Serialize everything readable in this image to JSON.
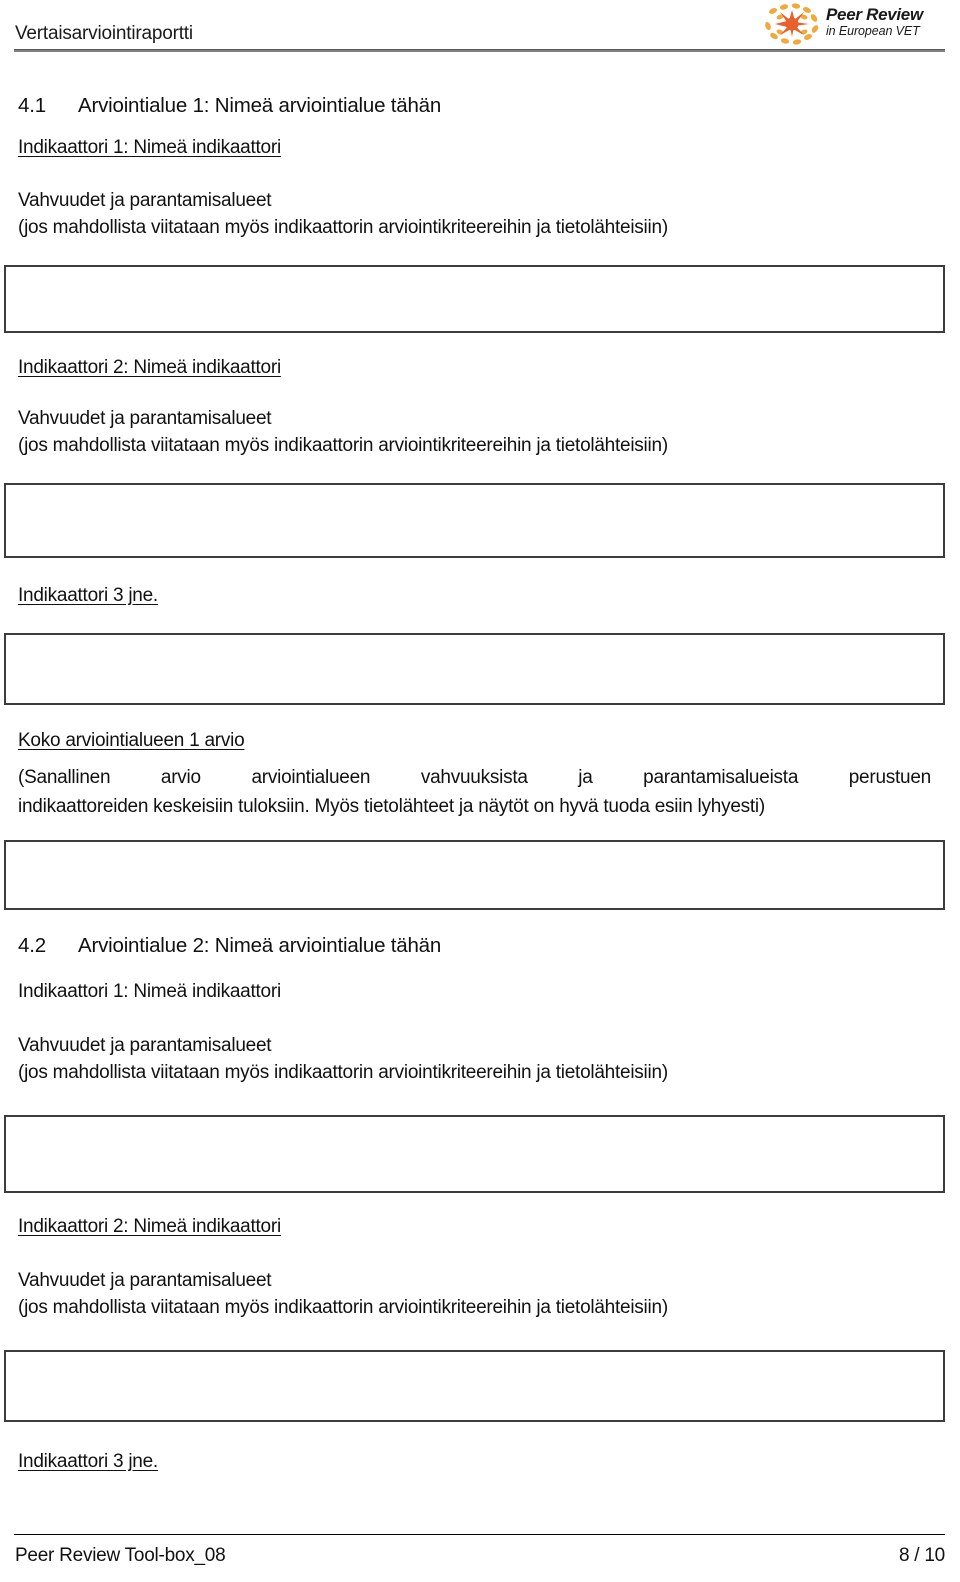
{
  "header": {
    "title": "Vertaisarviointiraportti",
    "logo": {
      "line1": "Peer Review",
      "line2": "in European VET",
      "burst_color": "#E8612C",
      "dot_color": "#F2A93B"
    }
  },
  "sections": [
    {
      "number": "4.1",
      "title": "Arviointialue 1: Nimeä arviointialue tähän",
      "indicator1_label": "Indikaattori 1: Nimeä indikaattori",
      "strengths_label": "Vahvuudet ja parantamisalueet",
      "strengths_hint": "(jos mahdollista viitataan myös indikaattorin arviointikriteereihin ja tietolähteisiin)",
      "indicator2_label": "Indikaattori 2: Nimeä indikaattori",
      "strengths_label2": "Vahvuudet ja parantamisalueet",
      "strengths_hint2": "(jos mahdollista viitataan myös indikaattorin arviointikriteereihin ja tietolähteisiin)",
      "indicator3_label": "Indikaattori 3 jne.",
      "overall_label": "Koko arviointialueen 1 arvio",
      "overall_hint_line1": "(Sanallinen arvio arviointialueen vahvuuksista ja parantamisalueista perustuen",
      "overall_hint_line2": "indikaattoreiden keskeisiin tuloksiin. Myös tietolähteet ja näytöt on hyvä tuoda esiin lyhyesti)"
    },
    {
      "number": "4.2",
      "title": "Arviointialue 2: Nimeä arviointialue tähän",
      "indicator1_label": "Indikaattori 1: Nimeä indikaattori",
      "strengths_label": "Vahvuudet ja parantamisalueet",
      "strengths_hint": "(jos mahdollista viitataan myös indikaattorin arviointikriteereihin ja tietolähteisiin)",
      "indicator2_label": "Indikaattori 2: Nimeä indikaattori",
      "strengths_label2": "Vahvuudet ja parantamisalueet",
      "strengths_hint2": "(jos mahdollista viitataan myös indikaattorin arviointikriteereihin ja tietolähteisiin)",
      "indicator3_label": "Indikaattori 3 jne."
    }
  ],
  "answer_boxes": {
    "placeholder": ""
  },
  "footer": {
    "left": "Peer Review Tool-box_08",
    "right": "8 / 10"
  }
}
